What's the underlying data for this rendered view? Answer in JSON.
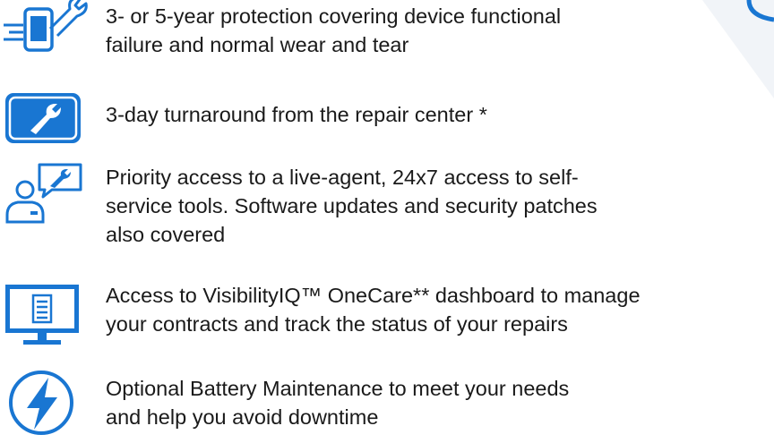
{
  "colors": {
    "accent": "#1976d2",
    "text": "#1a1a1a",
    "background": "#ffffff"
  },
  "features": [
    {
      "icon": "phone-wrench-icon",
      "text": "3- or 5-year protection covering device functional\nfailure and normal wear and tear"
    },
    {
      "icon": "wrench-badge-icon",
      "text": "3-day turnaround from the repair center *"
    },
    {
      "icon": "support-agent-icon",
      "text": "Priority access to a live-agent, 24x7 access to self-\nservice tools. Software updates and security patches\nalso covered"
    },
    {
      "icon": "monitor-icon",
      "text": "Access to VisibilityIQ™ OneCare** dashboard to manage\nyour contracts and track the status of your repairs"
    },
    {
      "icon": "lightning-bolt-icon",
      "text": "Optional Battery Maintenance to meet your needs\nand help you avoid downtime"
    }
  ]
}
